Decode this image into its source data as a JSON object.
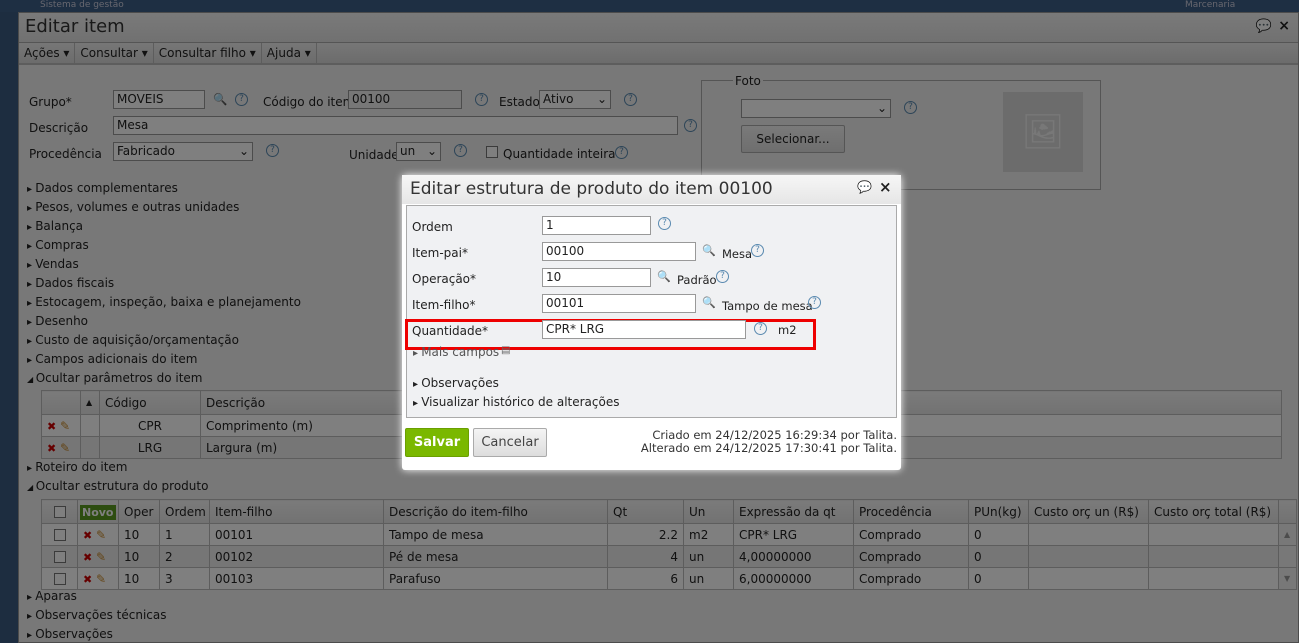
{
  "topbar": {
    "app": "Sistema de gestão",
    "company": "Marcenaria"
  },
  "window": {
    "title": "Editar item",
    "menu": [
      "Ações",
      "Consultar",
      "Consultar filho",
      "Ajuda"
    ]
  },
  "form": {
    "grupo_label": "Grupo*",
    "grupo": "MOVEIS",
    "codigo_label": "Código do item",
    "codigo": "00100",
    "estado_label": "Estado",
    "estado": "Ativo",
    "descricao_label": "Descrição",
    "descricao": "Mesa",
    "procedencia_label": "Procedência",
    "procedencia": "Fabricado",
    "unidade_label": "Unidade",
    "unidade": "un",
    "qtd_inteira_label": "Quantidade inteira",
    "foto_label": "Foto",
    "selecionar": "Selecionar..."
  },
  "sections": [
    "Dados complementares",
    "Pesos, volumes e outras unidades",
    "Balança",
    "Compras",
    "Vendas",
    "Dados fiscais",
    "Estocagem, inspeção, baixa e planejamento",
    "Desenho",
    "Custo de aquisição/orçamentação",
    "Campos adicionais do item",
    "Ocultar parâmetros do item"
  ],
  "params": {
    "headers": [
      "Código",
      "Descrição"
    ],
    "rows": [
      [
        "CPR",
        "Comprimento (m)"
      ],
      [
        "LRG",
        "Largura (m)"
      ]
    ]
  },
  "sections2": [
    "Roteiro do item",
    "Ocultar estrutura do produto"
  ],
  "structure": {
    "novo": "Novo",
    "headers": [
      "Oper",
      "Ordem",
      "Item-filho",
      "Descrição do item-filho",
      "Qt",
      "Un",
      "Expressão da qt",
      "Procedência",
      "PUn(kg)",
      "Custo orç un (R$)",
      "Custo orç total (R$)"
    ],
    "rows": [
      [
        "10",
        "1",
        "00101",
        "Tampo de mesa",
        "2.2",
        "m2",
        "CPR* LRG",
        "Comprado",
        "0",
        "",
        ""
      ],
      [
        "10",
        "2",
        "00102",
        "Pé de mesa",
        "4",
        "un",
        "4,00000000",
        "Comprado",
        "0",
        "",
        ""
      ],
      [
        "10",
        "3",
        "00103",
        "Parafuso",
        "6",
        "un",
        "6,00000000",
        "Comprado",
        "0",
        "",
        ""
      ]
    ]
  },
  "sections3": [
    "Aparas",
    "Observações técnicas",
    "Observações"
  ],
  "dialog": {
    "title": "Editar estrutura de produto do item 00100",
    "ordem_label": "Ordem",
    "ordem": "1",
    "itempai_label": "Item-pai*",
    "itempai": "00100",
    "itempai_desc": "Mesa",
    "operacao_label": "Operação*",
    "operacao": "10",
    "operacao_desc": "Padrão",
    "itemfilho_label": "Item-filho*",
    "itemfilho": "00101",
    "itemfilho_desc": "Tampo de mesa",
    "quantidade_label": "Quantidade*",
    "quantidade": "CPR* LRG",
    "quantidade_unit": "m2",
    "mais_campos": "Mais campos",
    "observacoes": "Observações",
    "historico": "Visualizar histórico de alterações",
    "salvar": "Salvar",
    "cancelar": "Cancelar",
    "criado": "Criado em 24/12/2025 16:29:34 por Talita.",
    "alterado": "Alterado em 24/12/2025 17:30:41 por Talita."
  },
  "colors": {
    "highlight": "#f5b414",
    "save": "#7ab800",
    "annotation": "#e00000"
  }
}
